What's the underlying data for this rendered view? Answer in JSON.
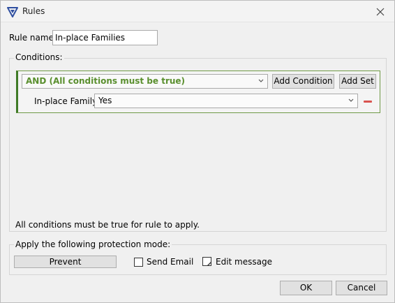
{
  "window": {
    "title": "Rules"
  },
  "rule": {
    "name_label": "Rule name:",
    "name_value": "In-place Families"
  },
  "conditions": {
    "legend": "Conditions:",
    "operator_selected": "AND (All conditions must be true)",
    "add_condition_label": "Add Condition",
    "add_set_label": "Add Set",
    "rows": [
      {
        "label": "In-place Family:",
        "value": "Yes"
      }
    ],
    "footer_note": "All conditions must be true for rule to apply."
  },
  "protection": {
    "legend": "Apply the following protection mode:",
    "mode_button_label": "Prevent",
    "send_email_label": "Send Email",
    "edit_message_label": "Edit message"
  },
  "buttons": {
    "ok_label": "OK",
    "cancel_label": "Cancel"
  },
  "colors": {
    "accent_green": "#3f7a26",
    "operator_text": "#5a8f2e",
    "remove_red": "#d9534f",
    "app_icon": "#2f4fa0"
  }
}
